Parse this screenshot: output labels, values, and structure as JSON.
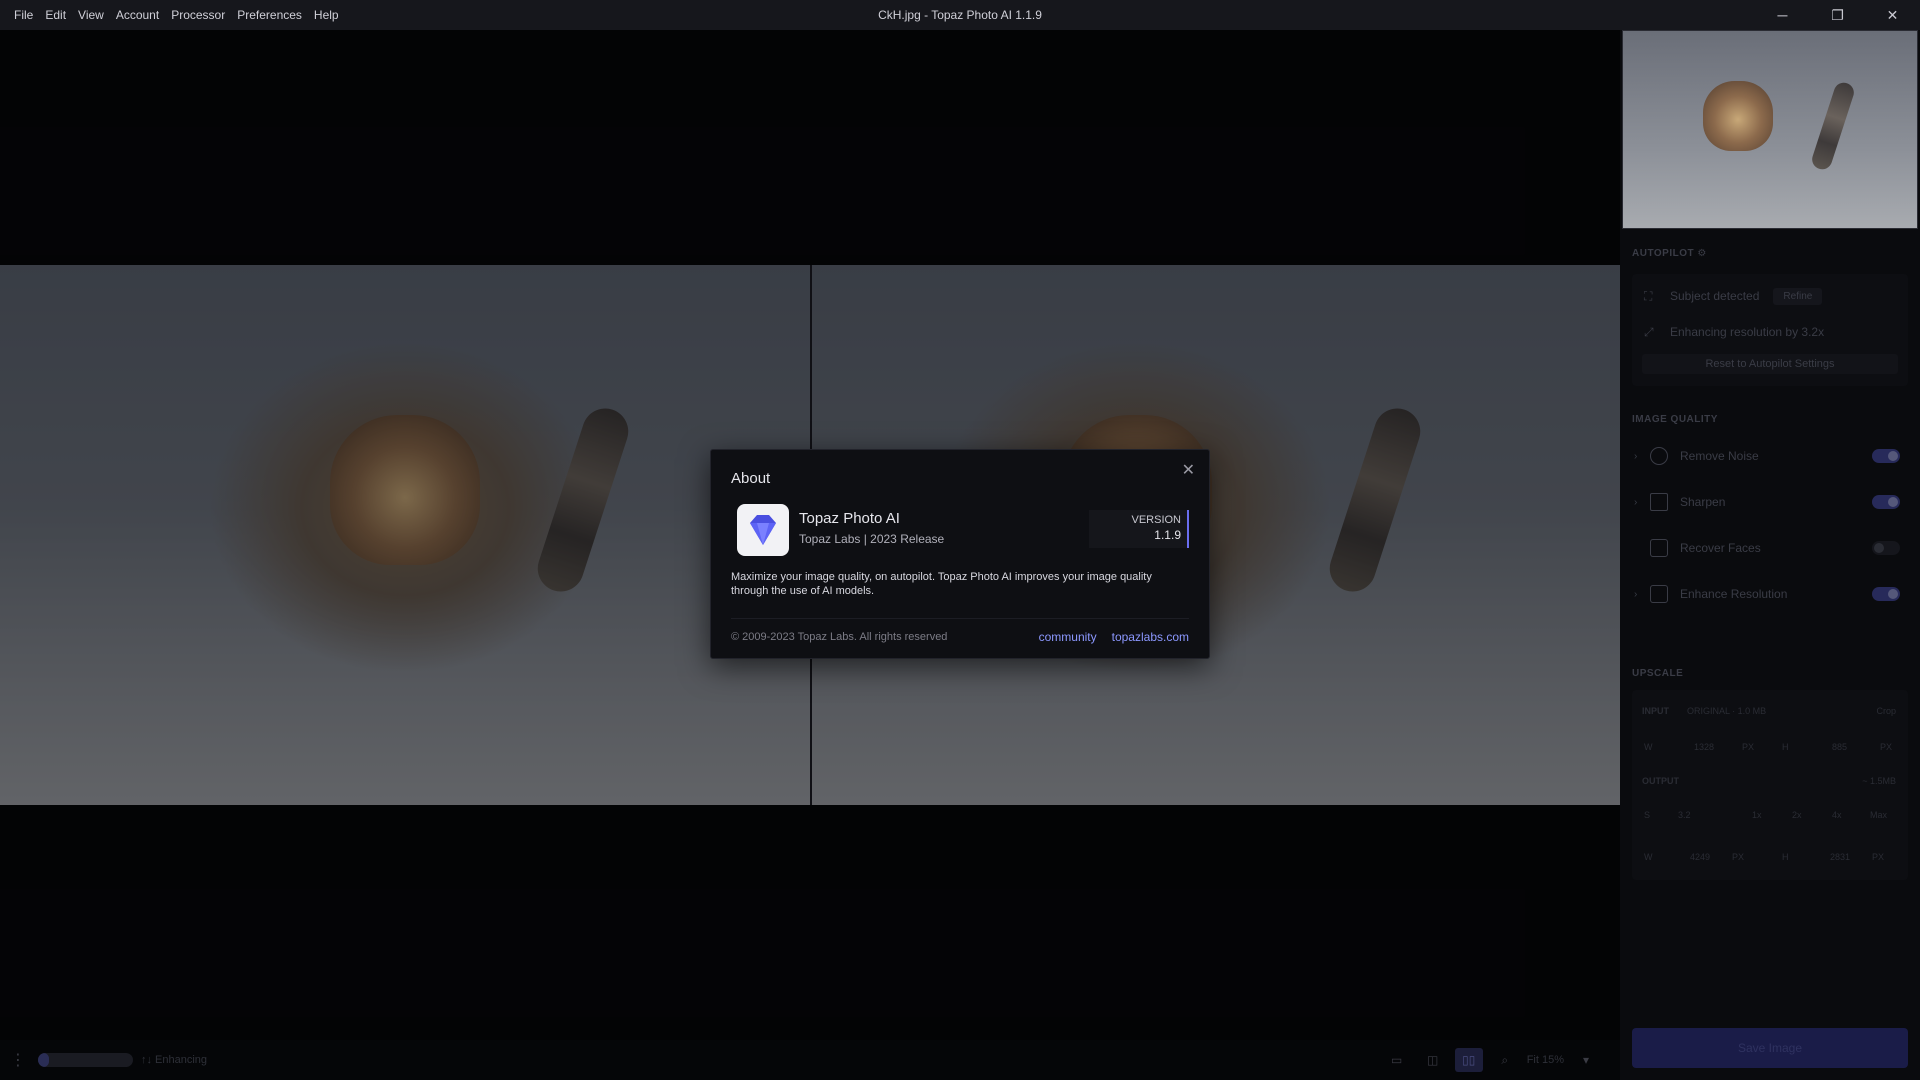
{
  "menu": [
    "File",
    "Edit",
    "View",
    "Account",
    "Processor",
    "Preferences",
    "Help"
  ],
  "window_title": "CkH.jpg - Topaz Photo AI 1.1.9",
  "window_controls": {
    "minimize": "─",
    "maximize": "❐",
    "close": "✕"
  },
  "statusbar": {
    "status_text": "↑↓ Enhancing",
    "zoom": "Fit 15%",
    "progress": 0.12
  },
  "panel": {
    "autopilot_label": "AUTOPILOT",
    "subject_detected": "Subject detected",
    "refine_label": "Refine",
    "enhancing_text": "Enhancing resolution by 3.2x",
    "reset_label": "Reset to Autopilot Settings",
    "image_quality_label": "IMAGE QUALITY",
    "quality_items": [
      {
        "label": "Remove Noise",
        "on": true
      },
      {
        "label": "Sharpen",
        "on": true
      },
      {
        "label": "Recover Faces",
        "on": false
      },
      {
        "label": "Enhance Resolution",
        "on": true
      }
    ],
    "upscale_label": "UPSCALE",
    "input_label": "INPUT",
    "input_meta": "ORIGINAL · 1.0 MB",
    "crop_label": "Crop",
    "input_w": "1328",
    "input_h": "885",
    "output_label": "OUTPUT",
    "output_meta": "~ 1.5MB",
    "scale_value": "3.2",
    "scale_opts": [
      "1x",
      "2x",
      "4x",
      "Max"
    ],
    "output_w": "4249",
    "output_h": "2831",
    "unit": "PX",
    "save_label": "Save Image"
  },
  "dialog": {
    "title": "About",
    "app_name": "Topaz Photo AI",
    "app_sub": "Topaz Labs | 2023 Release",
    "version_label": "VERSION",
    "version_value": "1.1.9",
    "description": "Maximize your image quality, on autopilot. Topaz Photo AI improves your image quality through the use of AI models.",
    "copyright": "© 2009-2023 Topaz Labs. All rights reserved",
    "links": [
      "community",
      "topazlabs.com"
    ]
  }
}
